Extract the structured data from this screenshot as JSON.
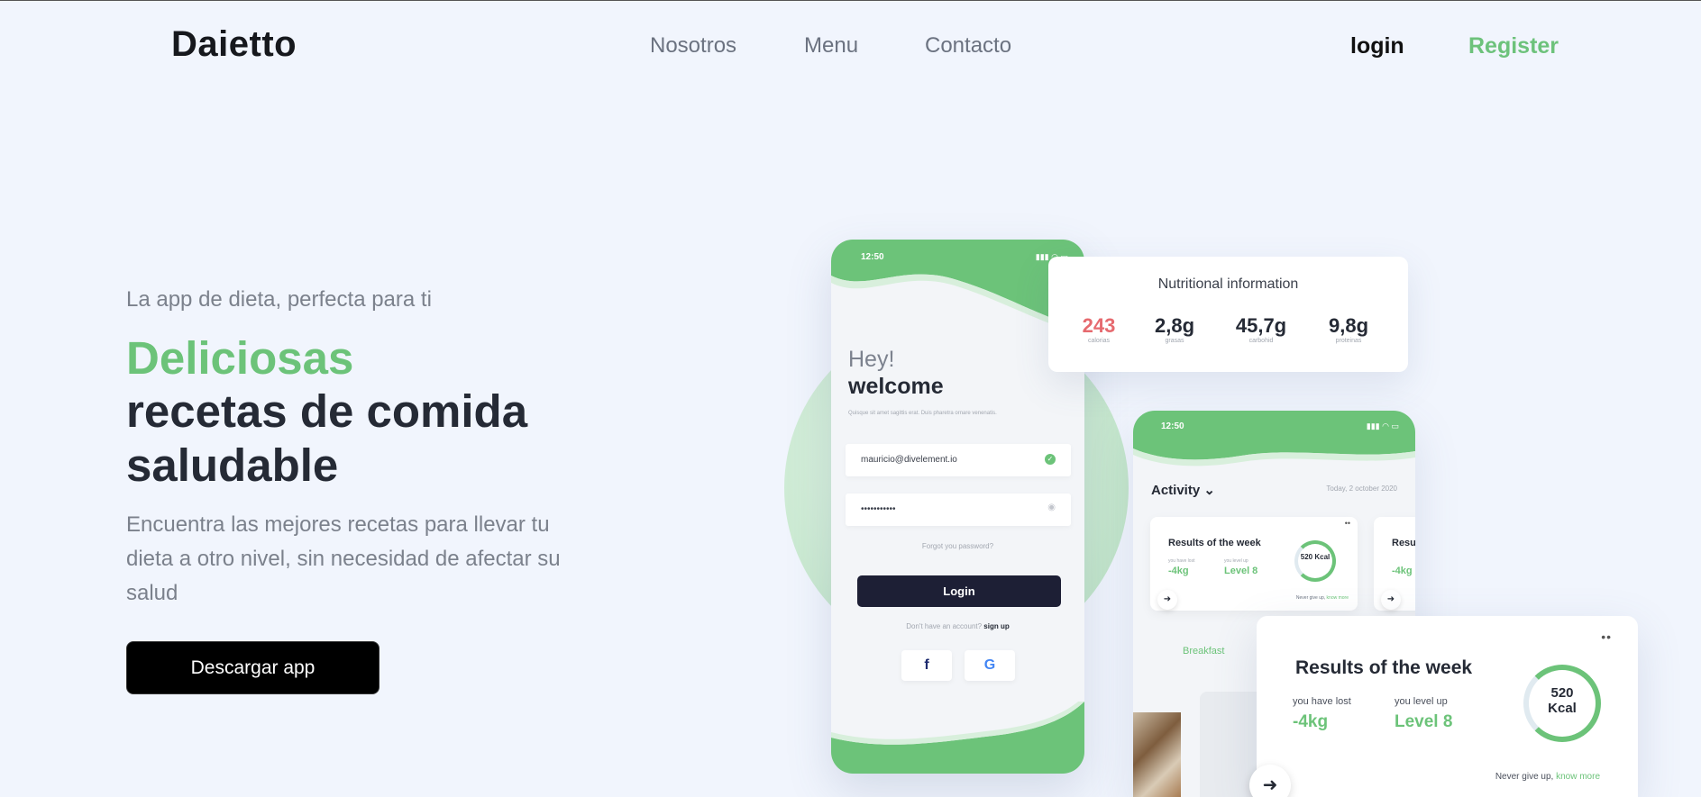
{
  "brand": {
    "logo": "Daietto"
  },
  "nav": {
    "links": [
      "Nosotros",
      "Menu",
      "Contacto"
    ],
    "login": "login",
    "register": "Register"
  },
  "hero": {
    "eyebrow": "La app de dieta, perfecta para ti",
    "headline_accent": "Deliciosas",
    "headline_rest": "recetas de comida saludable",
    "description": "Encuentra las mejores recetas para llevar tu dieta a otro nivel, sin necesidad de afectar su salud",
    "cta": "Descargar app"
  },
  "mockup": {
    "phone_login": {
      "time": "12:50",
      "greeting": "Hey!",
      "welcome": "welcome",
      "subtext": "Quisque sit amet sagittis erat. Duis pharetra ornare venenatis.",
      "email": "mauricio@divelement.io",
      "password": "•••••••••••",
      "forgot": "Forgot you password?",
      "login_button": "Login",
      "signup_prompt": "Don't have an account?",
      "signup_link": "sign up",
      "social": [
        "f",
        "G"
      ]
    },
    "nutrition": {
      "title": "Nutritional information",
      "items": [
        {
          "value": "243",
          "label": "calorias"
        },
        {
          "value": "2,8g",
          "label": "grasas"
        },
        {
          "value": "45,7g",
          "label": "carbohid"
        },
        {
          "value": "9,8g",
          "label": "proteinas"
        }
      ]
    },
    "phone_activity": {
      "time": "12:50",
      "title": "Activity",
      "date": "Today, 2 october 2020",
      "card_title": "Results of the week",
      "card_title_partial": "Resu",
      "lost_label": "you have lost",
      "lost_value": "-4kg",
      "level_label": "you level up",
      "level_value": "Level 8",
      "ring": "520 Kcal",
      "footer_text": "Never give up,",
      "footer_link": "know more",
      "breakfast": "Breakfast"
    },
    "results_card": {
      "title": "Results of the week",
      "lost_label": "you have lost",
      "lost_value": "-4kg",
      "level_label": "you level up",
      "level_value": "Level 8",
      "ring_value": "520",
      "ring_unit": "Kcal",
      "footer_text": "Never give up,",
      "footer_link": "know more"
    }
  },
  "colors": {
    "accent": "#6cc379",
    "dark": "#252a35",
    "calorie": "#e66a6f",
    "bg": "#f1f5fd"
  }
}
